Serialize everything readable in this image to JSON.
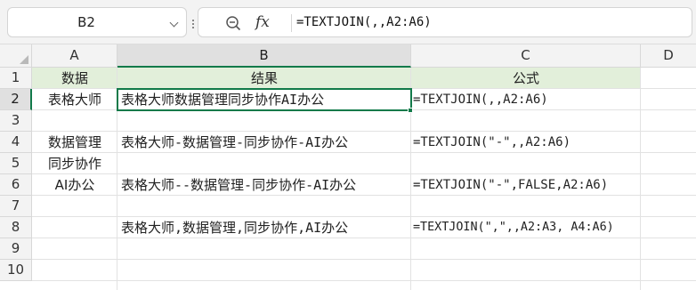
{
  "formula_bar": {
    "name_box": "B2",
    "fx_label": "fx",
    "formula": "=TEXTJOIN(,,A2:A6)"
  },
  "columns": [
    "A",
    "B",
    "C",
    "D"
  ],
  "rows": [
    "1",
    "2",
    "3",
    "4",
    "5",
    "6",
    "7",
    "8",
    "9",
    "10"
  ],
  "cells": {
    "A1": "数据",
    "B1": "结果",
    "C1": "公式",
    "A2": "表格大师",
    "B2": "表格大师数据管理同步协作AI办公",
    "C2": "=TEXTJOIN(,,A2:A6)",
    "A4": "数据管理",
    "B4": "表格大师-数据管理-同步协作-AI办公",
    "C4": "=TEXTJOIN(\"-\",,A2:A6)",
    "A5": "同步协作",
    "A6": "AI办公",
    "B6": "表格大师--数据管理-同步协作-AI办公",
    "C6": "=TEXTJOIN(\"-\",FALSE,A2:A6)",
    "B8": "表格大师,数据管理,同步协作,AI办公",
    "C8": "=TEXTJOIN(\",\",,A2:A3, A4:A6)"
  },
  "selection": {
    "cell": "B2"
  },
  "colors": {
    "accent": "#127a4a",
    "header_fill": "#e2efda"
  },
  "icons": {
    "zoom": "zoom-minus-icon",
    "caret": "chevron-down-icon"
  }
}
